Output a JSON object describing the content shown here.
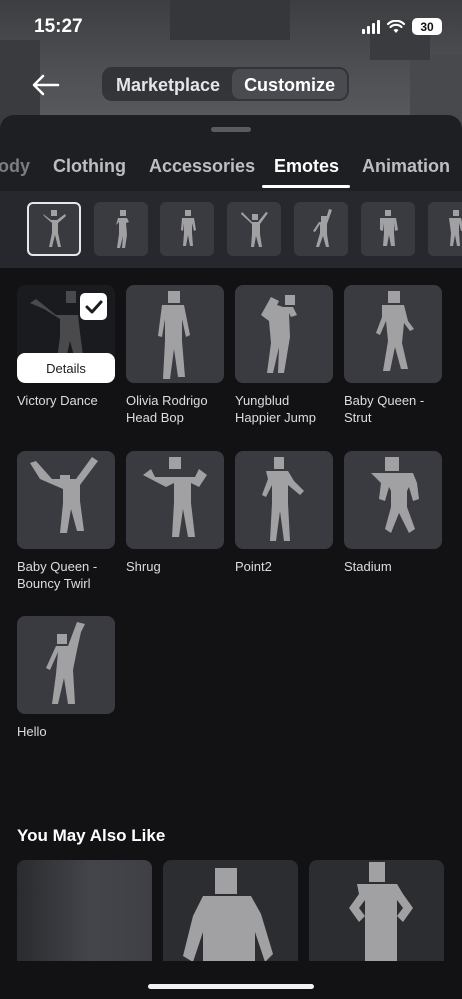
{
  "status": {
    "time": "15:27",
    "battery": "30"
  },
  "header": {
    "toggle": [
      "Marketplace",
      "Customize"
    ],
    "active_toggle": "Customize"
  },
  "tabs": [
    "ody",
    "Clothing",
    "Accessories",
    "Emotes",
    "Animation"
  ],
  "active_tab": "Emotes",
  "emotes": [
    {
      "name": "Victory Dance",
      "selected": true,
      "details_label": "Details"
    },
    {
      "name": "Olivia Rodrigo Head Bop"
    },
    {
      "name": "Yungblud Happier Jump"
    },
    {
      "name": "Baby Queen - Strut"
    },
    {
      "name": "Baby Queen - Bouncy Twirl"
    },
    {
      "name": "Shrug"
    },
    {
      "name": "Point2"
    },
    {
      "name": "Stadium"
    },
    {
      "name": "Hello"
    }
  ],
  "recommendations": {
    "title": "You May Also Like"
  },
  "icons": {
    "back": "arrow-left-icon",
    "check": "checkmark-icon",
    "wifi": "wifi-icon",
    "signal": "cellular-signal-icon",
    "battery": "battery-icon"
  },
  "colors": {
    "background": "#121215",
    "sheet": "#1e1f23",
    "tile": "#3a3b40",
    "figure": "#a1a1a3"
  }
}
